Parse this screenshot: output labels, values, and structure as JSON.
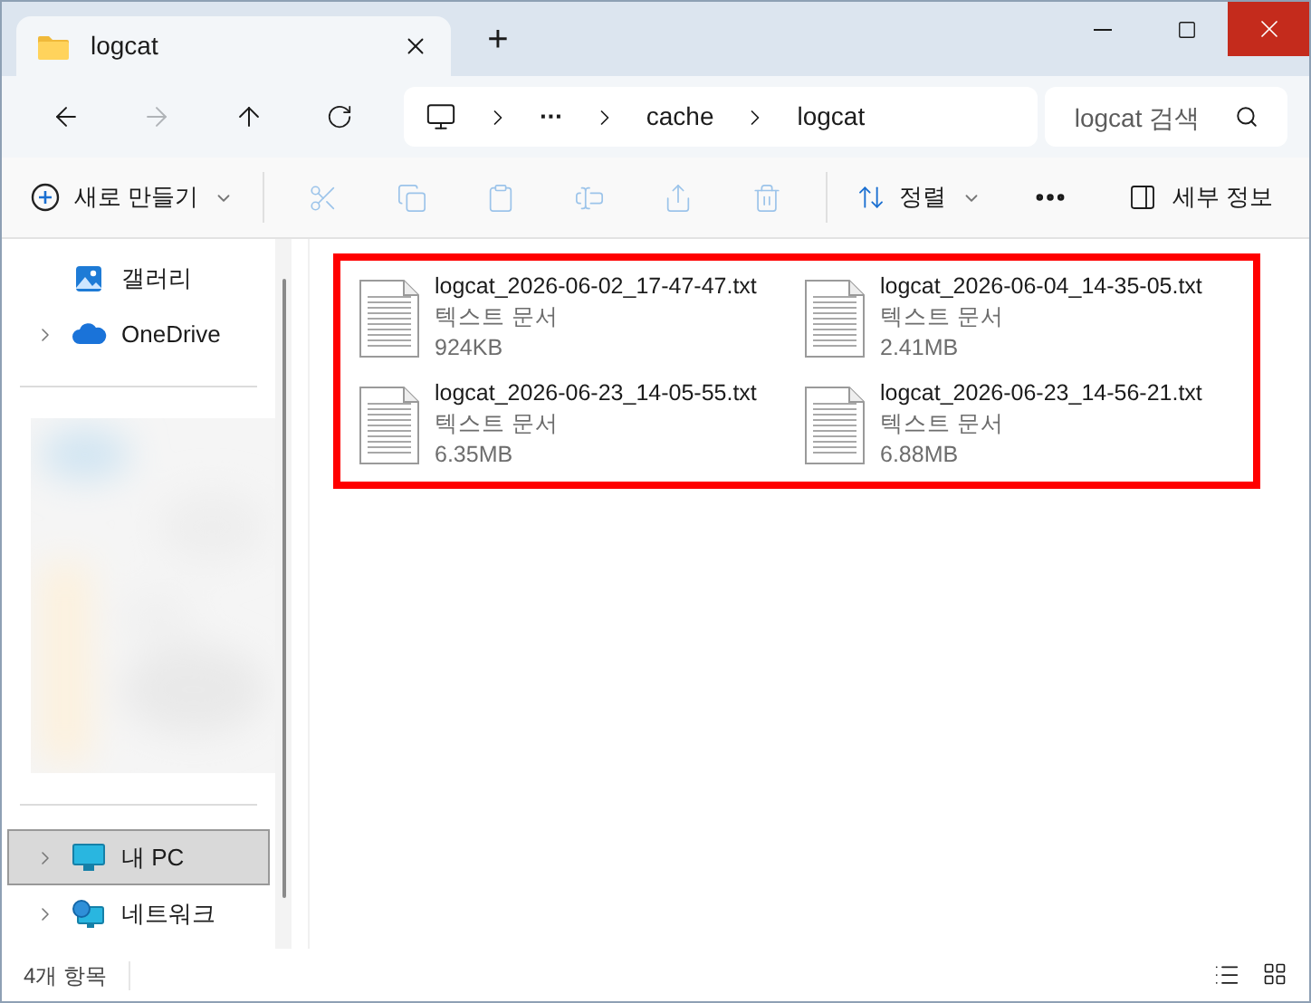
{
  "window": {
    "tab_title": "logcat",
    "new_tab": "+"
  },
  "nav": {
    "breadcrumb": [
      {
        "kind": "computer"
      },
      {
        "kind": "ellipsis",
        "label": "···"
      },
      {
        "kind": "folder",
        "label": "cache"
      },
      {
        "kind": "folder",
        "label": "logcat"
      }
    ],
    "search": {
      "placeholder": "logcat 검색"
    }
  },
  "toolbar": {
    "new_button": "새로 만들기",
    "actions": [
      {
        "kind": "cut",
        "disabled": true
      },
      {
        "kind": "copy",
        "disabled": true
      },
      {
        "kind": "paste",
        "disabled": true
      },
      {
        "kind": "rename",
        "disabled": true
      },
      {
        "kind": "share",
        "disabled": true
      },
      {
        "kind": "delete",
        "disabled": true
      }
    ],
    "sort_button": "정렬",
    "details_button": "세부 정보"
  },
  "sidebar": {
    "items": [
      {
        "label": "갤러리",
        "kind": "gallery",
        "expandable": false,
        "selected": false
      },
      {
        "label": "OneDrive",
        "kind": "cloud",
        "expandable": true,
        "selected": false
      },
      {
        "kind": "blurred"
      },
      {
        "label": "내 PC",
        "kind": "pc",
        "expandable": true,
        "selected": true
      },
      {
        "label": "네트워크",
        "kind": "network",
        "expandable": true,
        "selected": false
      }
    ]
  },
  "files": [
    {
      "name": "logcat_2026-06-02_17-47-47.txt",
      "type": "텍스트 문서",
      "size": "924KB"
    },
    {
      "name": "logcat_2026-06-04_14-35-05.txt",
      "type": "텍스트 문서",
      "size": "2.41MB"
    },
    {
      "name": "logcat_2026-06-23_14-05-55.txt",
      "type": "텍스트 문서",
      "size": "6.35MB"
    },
    {
      "name": "logcat_2026-06-23_14-56-21.txt",
      "type": "텍스트 문서",
      "size": "6.88MB"
    }
  ],
  "highlight": {
    "shown": true
  },
  "status_bar": {
    "count": "4개 항목"
  }
}
